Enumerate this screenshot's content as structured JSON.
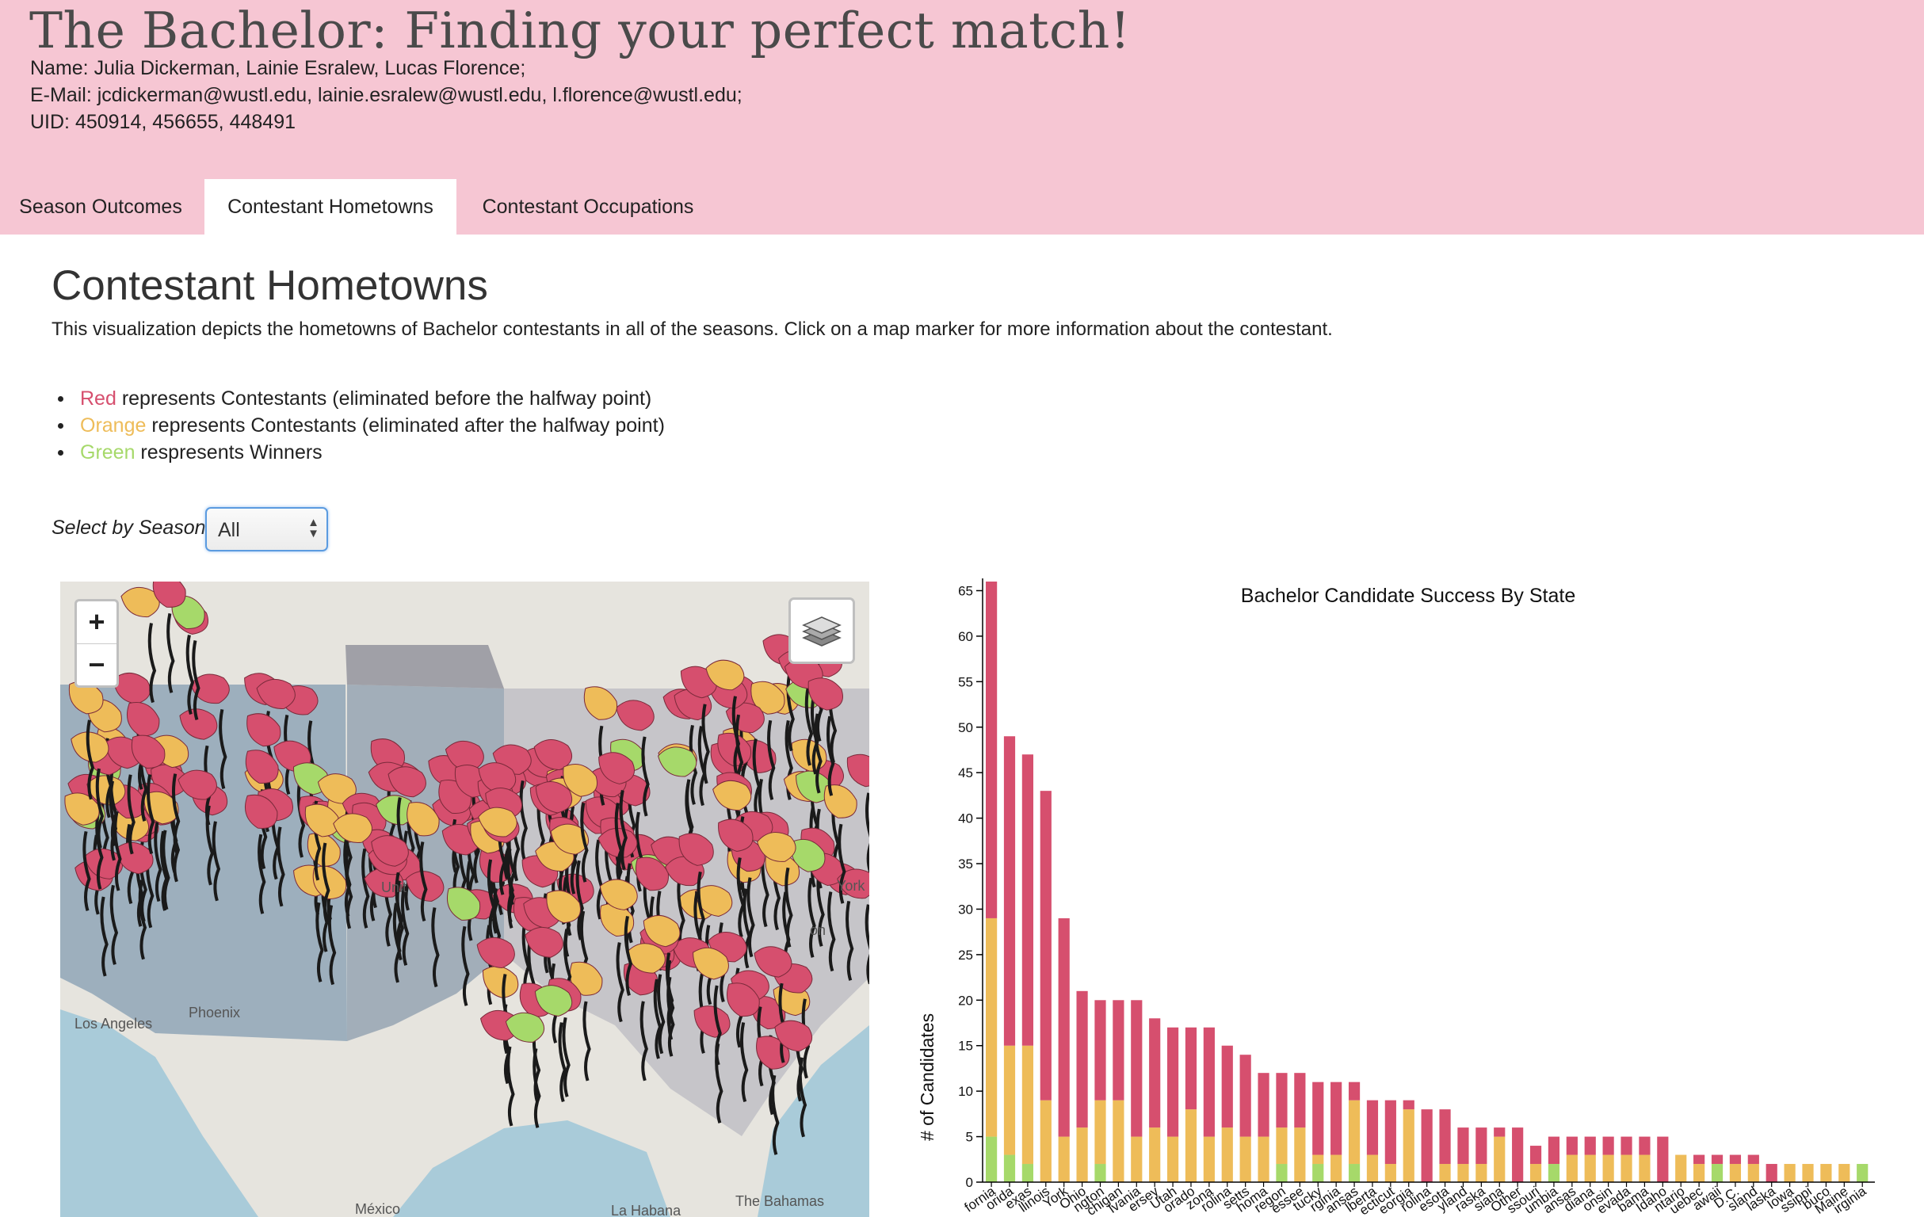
{
  "header": {
    "title": "The Bachelor: Finding your perfect match!",
    "names": "Name: Julia Dickerman, Lainie Esralew, Lucas Florence;",
    "emails": "E-Mail: jcdickerman@wustl.edu, lainie.esralew@wustl.edu, l.florence@wustl.edu;",
    "uids": "UID: 450914, 456655, 448491"
  },
  "tabs": [
    {
      "label": "Season Outcomes",
      "active": false
    },
    {
      "label": "Contestant Hometowns",
      "active": true
    },
    {
      "label": "Contestant Occupations",
      "active": false
    }
  ],
  "main": {
    "heading": "Contestant Hometowns",
    "description": "This visualization depicts the hometowns of Bachelor contestants in all of the seasons. Click on a map marker for more information about the contestant.",
    "legend": [
      {
        "color_word": "Red",
        "color": "#d64f6e",
        "text": " represents Contestants (eliminated before the halfway point)"
      },
      {
        "color_word": "Orange",
        "color": "#eebc59",
        "text": " represents Contestants (eliminated after the halfway point)"
      },
      {
        "color_word": "Green",
        "color": "#a6d96a",
        "text": " respresents Winners"
      }
    ],
    "season_label": "Select by Season:",
    "season_value": "All"
  },
  "map": {
    "zoom_in": "+",
    "zoom_out": "−",
    "layers_icon": "layers-icon",
    "labels": {
      "united": "Unit",
      "york": "York",
      "los_angeles": "Los Angeles",
      "phoenix": "Phoenix",
      "mexico": "México",
      "habana": "La Habana",
      "bahamas": "The Bahamas",
      "on": "on"
    },
    "marker_colors": {
      "red": "#d64f6e",
      "orange": "#eebc59",
      "green": "#a6d96a"
    }
  },
  "chart_data": {
    "type": "bar",
    "stacked": true,
    "title": "Bachelor Candidate Success By State",
    "ylabel": "# of Candidates",
    "xlabel": "",
    "ylim": [
      0,
      66
    ],
    "yticks": [
      0,
      5,
      10,
      15,
      20,
      25,
      30,
      35,
      40,
      45,
      50,
      55,
      60,
      65
    ],
    "categories": [
      "California",
      "Florida",
      "Texas",
      "Illinois",
      "New York",
      "Ohio",
      "Washington",
      "Michigan",
      "Pennsylvania",
      "New Jersey",
      "Utah",
      "Colorado",
      "Arizona",
      "North Carolina",
      "Massachusetts",
      "Oklahoma",
      "Oregon",
      "Tennessee",
      "Kentucky",
      "Virginia",
      "Kansas",
      "Alberta",
      "Connecticut",
      "Georgia",
      "South Carolina",
      "Minnesota",
      "Maryland",
      "Nebraska",
      "Louisiana",
      "Other",
      "Missouri",
      "Columbia",
      "Arkansas",
      "Indiana",
      "Wisconsin",
      "Nevada",
      "Alabama",
      "Idaho",
      "Ontario",
      "Quebec",
      "Hawaii",
      "D.C.",
      "Rhode Island",
      "Alaska",
      "Iowa",
      "Mississippi",
      "Pernambuco",
      "Maine",
      "Virginia"
    ],
    "tick_labels": [
      "fornia",
      "orida",
      "exas",
      "llinois",
      "York",
      "Ohio",
      "ngton",
      "chigan",
      "lvania",
      "ersey",
      "Utah",
      "orado",
      "zona",
      "rolina",
      "setts",
      "homa",
      "regon",
      "essee",
      "tucky",
      "rginia",
      "ansas",
      "lberta",
      "ecticut",
      "eorgia",
      "rolina",
      "esota",
      "yland",
      "raska",
      "siana",
      "Other",
      "ssouri",
      "umbia",
      "ansas",
      "diana",
      "onsin",
      "evada",
      "bama",
      "Idaho",
      "ntario",
      "uebec",
      "awaii",
      "D.C.",
      "sland",
      "laska",
      "Iowa",
      "ssippi",
      "buco",
      "Maine",
      "irginia"
    ],
    "series": [
      {
        "name": "Winners",
        "color": "#a6d96a",
        "values": [
          5,
          3,
          2,
          0,
          0,
          0,
          2,
          0,
          0,
          0,
          0,
          0,
          0,
          0,
          0,
          0,
          2,
          0,
          2,
          0,
          2,
          0,
          0,
          0,
          0,
          0,
          0,
          0,
          0,
          0,
          0,
          2,
          0,
          0,
          0,
          0,
          0,
          0,
          0,
          0,
          2,
          0,
          0,
          0,
          0,
          0,
          0,
          0,
          2
        ]
      },
      {
        "name": "Orange",
        "color": "#eebc59",
        "values": [
          24,
          12,
          13,
          9,
          5,
          6,
          7,
          9,
          5,
          6,
          5,
          8,
          5,
          6,
          5,
          5,
          4,
          6,
          1,
          3,
          7,
          3,
          2,
          8,
          0,
          2,
          2,
          2,
          5,
          0,
          2,
          0,
          3,
          3,
          3,
          3,
          3,
          0,
          3,
          2,
          0,
          2,
          2,
          0,
          2,
          2,
          2,
          2,
          0
        ]
      },
      {
        "name": "Red",
        "color": "#d64f6e",
        "values": [
          37,
          34,
          32,
          34,
          24,
          15,
          11,
          11,
          15,
          12,
          12,
          9,
          12,
          9,
          9,
          7,
          6,
          6,
          8,
          8,
          2,
          6,
          7,
          1,
          8,
          6,
          4,
          4,
          1,
          6,
          2,
          3,
          2,
          2,
          2,
          2,
          2,
          5,
          0,
          1,
          1,
          1,
          1,
          2,
          0,
          0,
          0,
          0,
          0
        ]
      }
    ]
  }
}
